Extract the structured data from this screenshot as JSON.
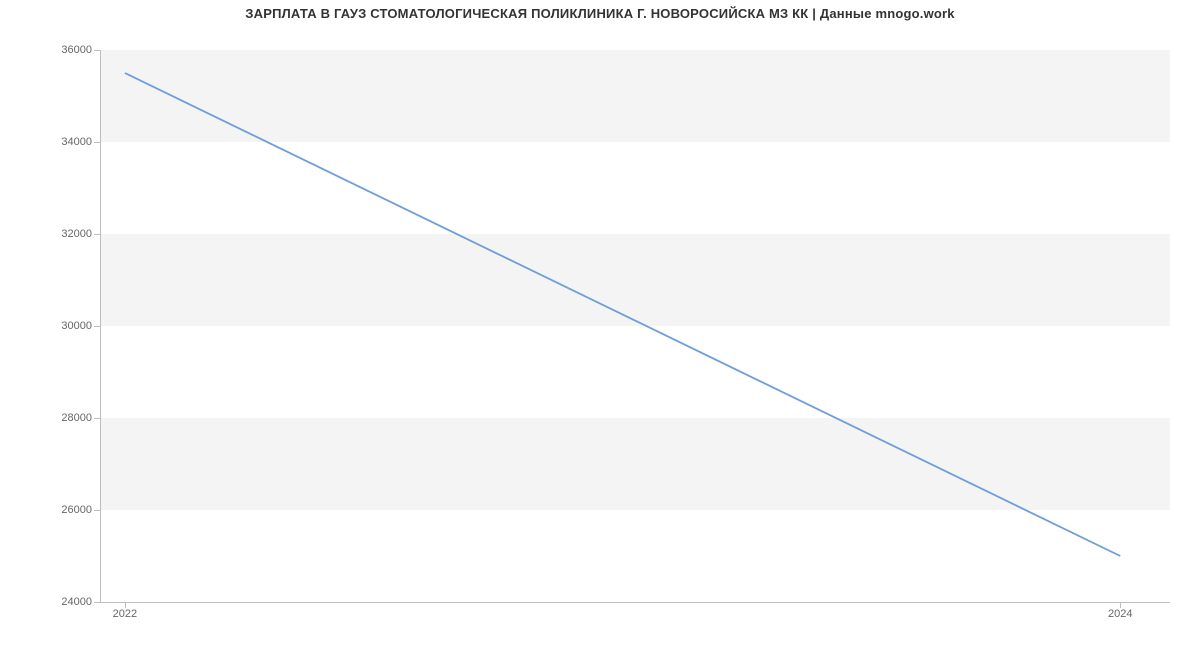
{
  "chart_data": {
    "type": "line",
    "title": "ЗАРПЛАТА В ГАУЗ СТОМАТОЛОГИЧЕСКАЯ ПОЛИКЛИНИКА Г. НОВОРОСИЙСКА МЗ КК | Данные mnogo.work",
    "x": [
      2022,
      2024
    ],
    "values": [
      35500,
      25000
    ],
    "x_ticks": [
      2022,
      2024
    ],
    "y_ticks": [
      24000,
      26000,
      28000,
      30000,
      32000,
      34000,
      36000
    ],
    "xlim": [
      2021.95,
      2024.1
    ],
    "ylim": [
      24000,
      36000
    ],
    "line_color": "#6f9ddb",
    "band_color": "#f4f4f4"
  }
}
